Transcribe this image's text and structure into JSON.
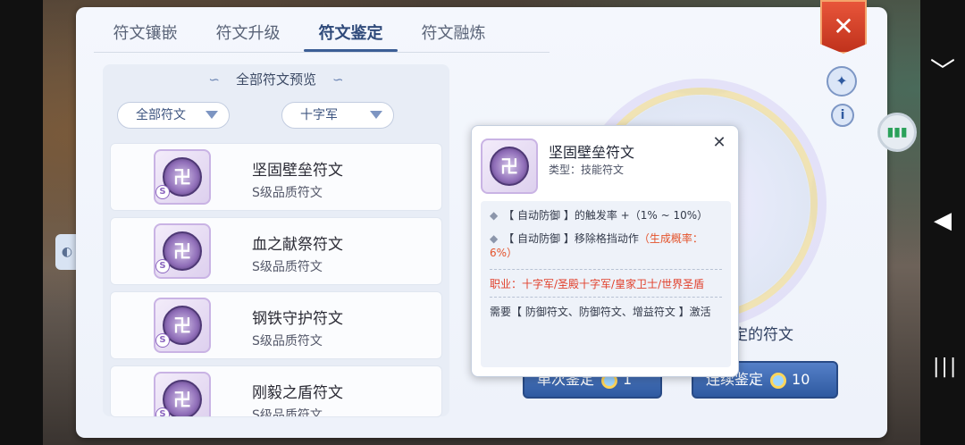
{
  "tabs": [
    {
      "label": "符文镶嵌",
      "active": false
    },
    {
      "label": "符文升级",
      "active": false
    },
    {
      "label": "符文鉴定",
      "active": true
    },
    {
      "label": "符文融炼",
      "active": false
    }
  ],
  "close_label": "✕",
  "panel": {
    "title": "全部符文预览",
    "filter_type": "全部符文",
    "filter_job": "十字军"
  },
  "runes": [
    {
      "name": "坚固壁垒符文",
      "grade": "S级品质符文",
      "badge": "S"
    },
    {
      "name": "血之献祭符文",
      "grade": "S级品质符文",
      "badge": "S"
    },
    {
      "name": "钢铁守护符文",
      "grade": "S级品质符文",
      "badge": "S"
    },
    {
      "name": "刚毅之盾符文",
      "grade": "S级品质符文",
      "badge": "S"
    }
  ],
  "tooltip": {
    "name": "坚固壁垒符文",
    "type": "类型：技能符文",
    "effect1": "【 自动防御 】的触发率 +（1% ~ 10%）",
    "effect2_prefix": "【 自动防御 】移除格挡动作",
    "effect2_red": "（生成概率：6%）",
    "job": "职业：十字军/圣殿十字军/皇家卫士/世界圣盾",
    "requirement": "需要【 防御符文、防御符文、增益符文 】激活",
    "close": "✕"
  },
  "hint_text": "定的符文",
  "buttons": {
    "single_label": "单次鉴定",
    "single_count": "1",
    "multi_label": "连续鉴定",
    "multi_count": "10"
  },
  "icons": {
    "wand": "✦",
    "info": "i",
    "chevron": "﹀",
    "back": "◀",
    "menu": "|||",
    "float": "▮▮▮"
  },
  "colors": {
    "accent": "#2f5aa0",
    "close": "#d9442a",
    "warn": "#e4532b"
  }
}
